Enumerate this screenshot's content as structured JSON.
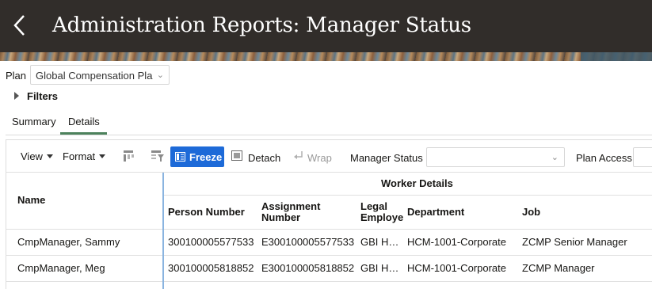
{
  "header": {
    "title": "Administration Reports: Manager Status"
  },
  "plan": {
    "label": "Plan",
    "value": "Global Compensation Plan"
  },
  "filters": {
    "label": "Filters"
  },
  "tabs": [
    {
      "label": "Summary",
      "selected": false
    },
    {
      "label": "Details",
      "selected": true
    }
  ],
  "toolbar": {
    "view_label": "View",
    "format_label": "Format",
    "freeze_label": "Freeze",
    "detach_label": "Detach",
    "wrap_label": "Wrap",
    "manager_status_label": "Manager Status",
    "manager_status_value": "",
    "plan_access_label": "Plan Access"
  },
  "table": {
    "group_header": "Worker Details",
    "columns": {
      "name": "Name",
      "person_number": "Person Number",
      "assignment_number": "Assignment Number",
      "legal_employer": "Legal Employer",
      "department": "Department",
      "job": "Job"
    },
    "rows": [
      {
        "name": "CmpManager, Sammy",
        "person_number": "300100005577533",
        "assignment_number": "E300100005577533",
        "legal_employer": "GBI H…",
        "department": "HCM-1001-Corporate",
        "job": "ZCMP Senior Manager"
      },
      {
        "name": "CmpManager, Meg",
        "person_number": "300100005818852",
        "assignment_number": "E300100005818852",
        "legal_employer": "GBI H…",
        "department": "HCM-1001-Corporate",
        "job": "ZCMP Manager"
      }
    ]
  },
  "colors": {
    "header_bg": "#312d2a",
    "accent_blue": "#1d6ad8",
    "tab_underline": "#4c825c"
  }
}
